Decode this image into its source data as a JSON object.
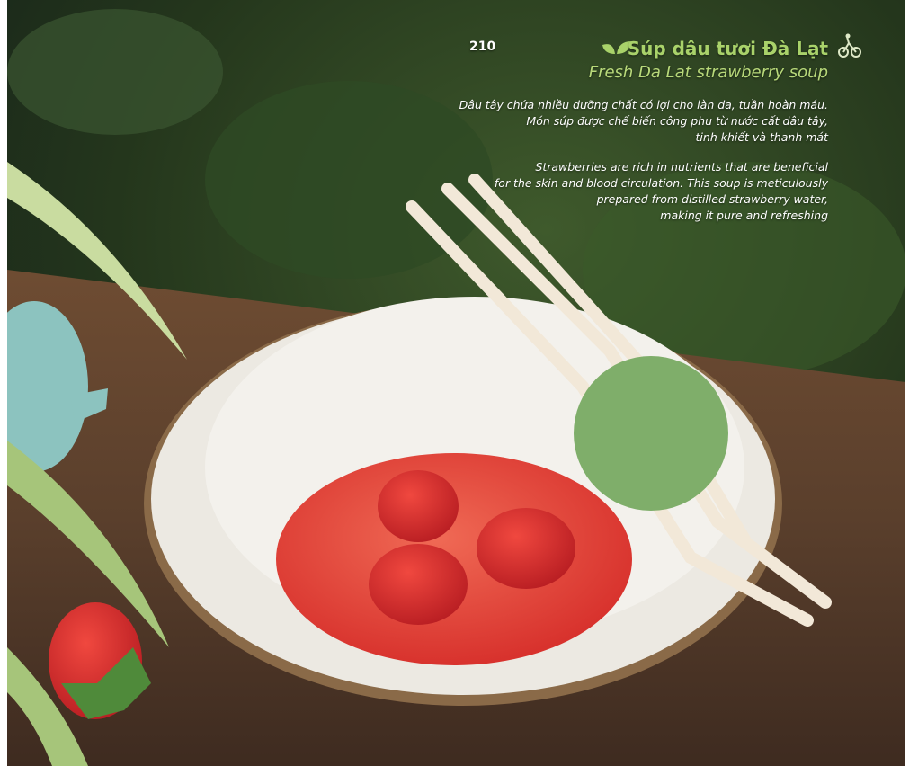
{
  "page": {
    "number": "210",
    "title_vi": "Súp dâu tươi Đà Lạt",
    "title_en": "Fresh Da Lat strawberry soup",
    "description_vi": [
      "Dâu tây chứa nhiều dưỡng chất có lợi cho làn da, tuần hoàn máu.",
      "Món súp được chế biến công phu từ nước cất dâu tây,",
      "tinh khiết và thanh mát"
    ],
    "description_en": [
      "Strawberries are rich in nutrients that are beneficial",
      "for the skin and blood circulation. This soup is meticulously",
      "prepared from distilled strawberry water,",
      "making it pure and refreshing"
    ],
    "icons": {
      "title": "leaf-icon",
      "logo": "scooter-logo"
    },
    "colors": {
      "title_accent": "#a9d26a",
      "soup": "#e0413a",
      "bowl": "#ece9e2",
      "wood": "#5a3f2c"
    }
  }
}
